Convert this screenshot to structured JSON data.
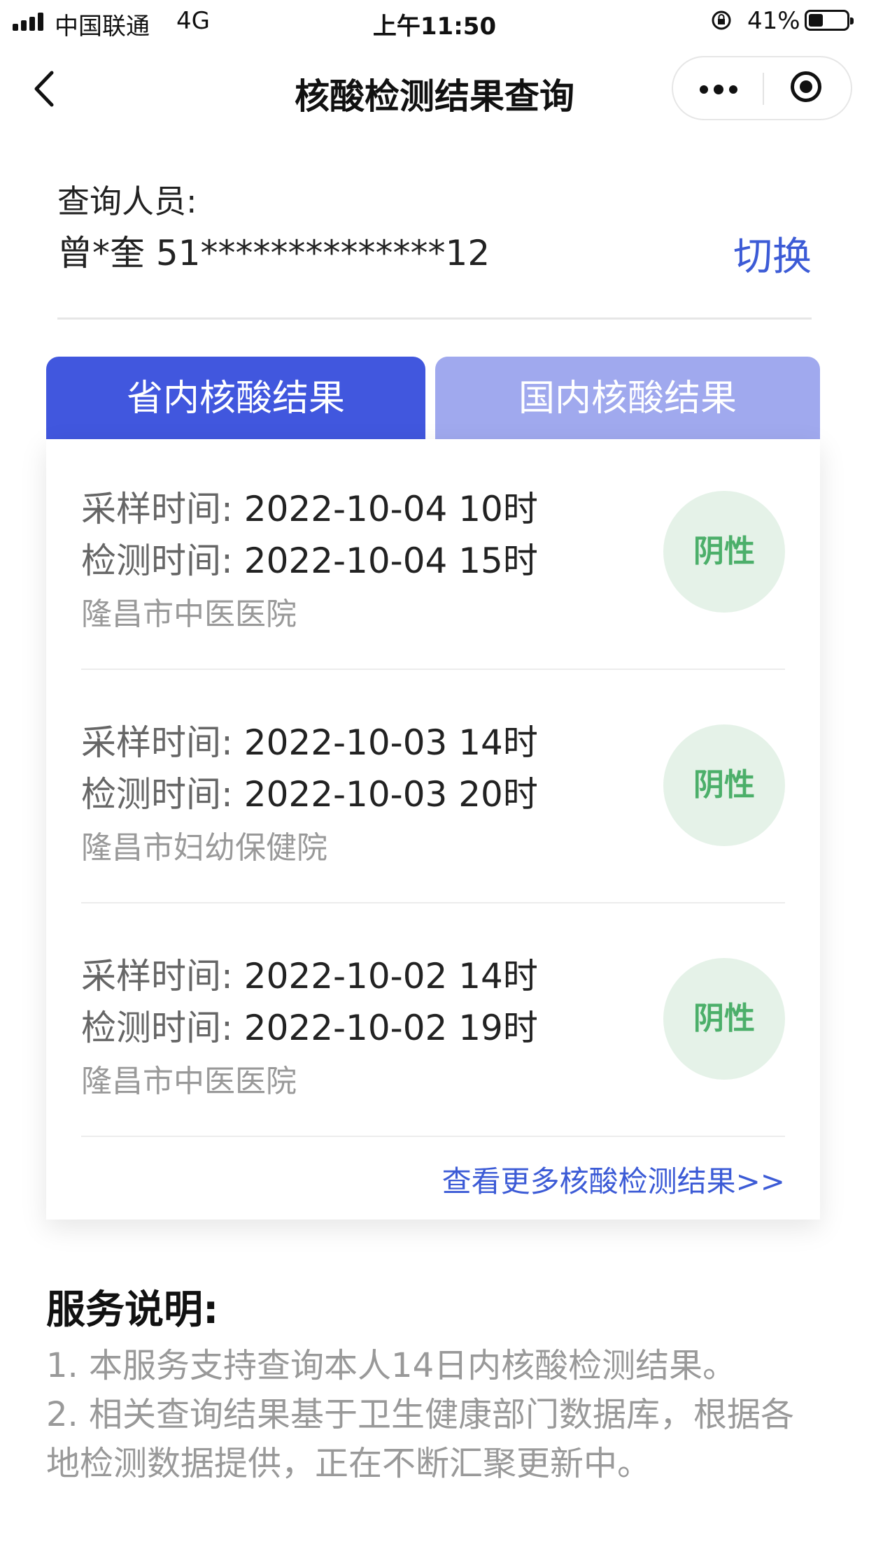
{
  "status_bar": {
    "carrier": "中国联通",
    "network": "4G",
    "time": "上午11:50",
    "battery": "41%",
    "battery_level": 0.41
  },
  "nav": {
    "title": "核酸检测结果查询"
  },
  "person": {
    "label": "查询人员:",
    "value": "曾*奎 51**************12",
    "switch_label": "切换"
  },
  "tabs": [
    {
      "label": "省内核酸结果",
      "active": true
    },
    {
      "label": "国内核酸结果",
      "active": false
    }
  ],
  "records": [
    {
      "sample_label": "采样时间:",
      "sample_time": "2022-10-04 10时",
      "test_label": "检测时间:",
      "test_time": "2022-10-04 15时",
      "hospital": "隆昌市中医医院",
      "result": "阴性"
    },
    {
      "sample_label": "采样时间:",
      "sample_time": "2022-10-03 14时",
      "test_label": "检测时间:",
      "test_time": "2022-10-03 20时",
      "hospital": "隆昌市妇幼保健院",
      "result": "阴性"
    },
    {
      "sample_label": "采样时间:",
      "sample_time": "2022-10-02 14时",
      "test_label": "检测时间:",
      "test_time": "2022-10-02 19时",
      "hospital": "隆昌市中医医院",
      "result": "阴性"
    }
  ],
  "more_link": "查看更多核酸检测结果>>",
  "notes": {
    "title": "服务说明:",
    "items": [
      "1. 本服务支持查询本人14日内核酸检测结果。",
      "2. 相关查询结果基于卫生健康部门数据库，根据各地检测数据提供，正在不断汇聚更新中。"
    ]
  },
  "colors": {
    "accent": "#3c5bd6",
    "tab_active": "#4157de",
    "tab_inactive": "#a0a9ee",
    "negative_badge_bg": "#e5f2e8",
    "negative_badge_text": "#4caf6a"
  }
}
